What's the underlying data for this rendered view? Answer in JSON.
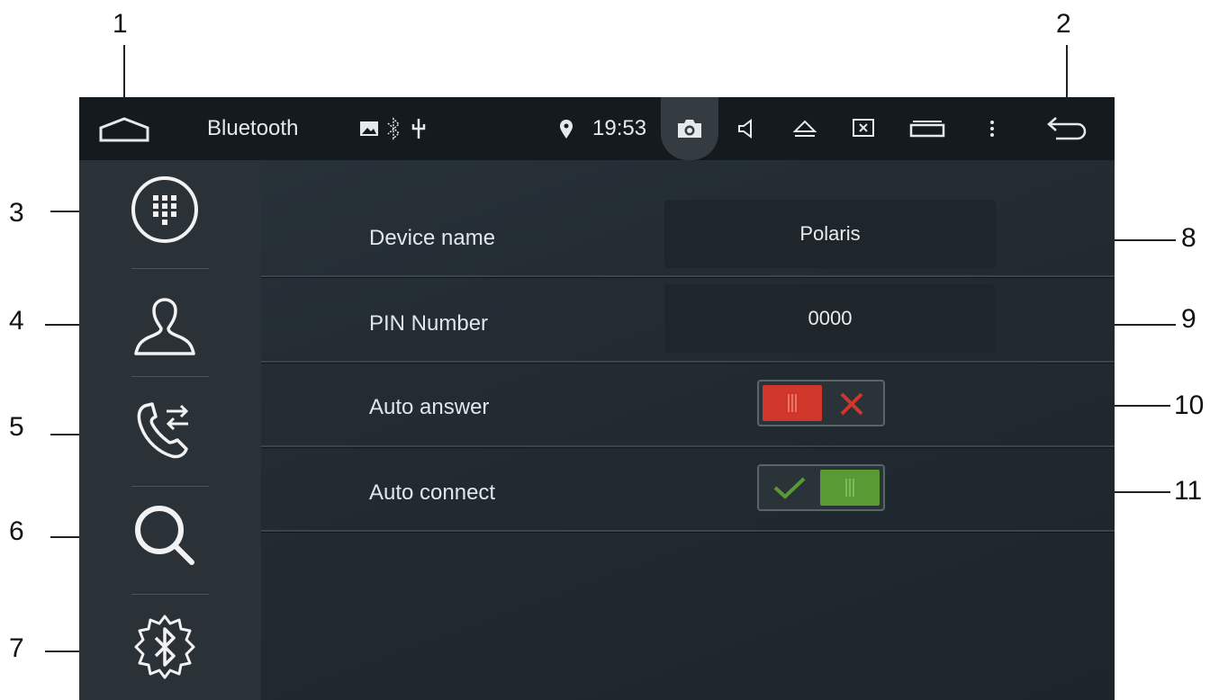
{
  "callouts": [
    "1",
    "2",
    "3",
    "4",
    "5",
    "6",
    "7",
    "8",
    "9",
    "10",
    "11"
  ],
  "statusbar": {
    "title": "Bluetooth",
    "time": "19:53",
    "icons": [
      "home-icon",
      "image-icon",
      "bluetooth-icon",
      "usb-icon",
      "location-icon",
      "camera-icon",
      "volume-icon",
      "eject-icon",
      "screen-off-icon",
      "recent-apps-icon",
      "more-icon",
      "back-icon"
    ]
  },
  "sidebar": {
    "items": [
      "dialpad-icon",
      "contacts-icon",
      "call-log-icon",
      "search-icon",
      "bluetooth-settings-icon"
    ]
  },
  "settings": {
    "device_name": {
      "label": "Device name",
      "value": "Polaris"
    },
    "pin": {
      "label": "PIN Number",
      "value": "0000"
    },
    "auto_answer": {
      "label": "Auto answer",
      "state": "off",
      "color": "#d1362b"
    },
    "auto_connect": {
      "label": "Auto connect",
      "state": "on",
      "color": "#5a9a34"
    }
  }
}
